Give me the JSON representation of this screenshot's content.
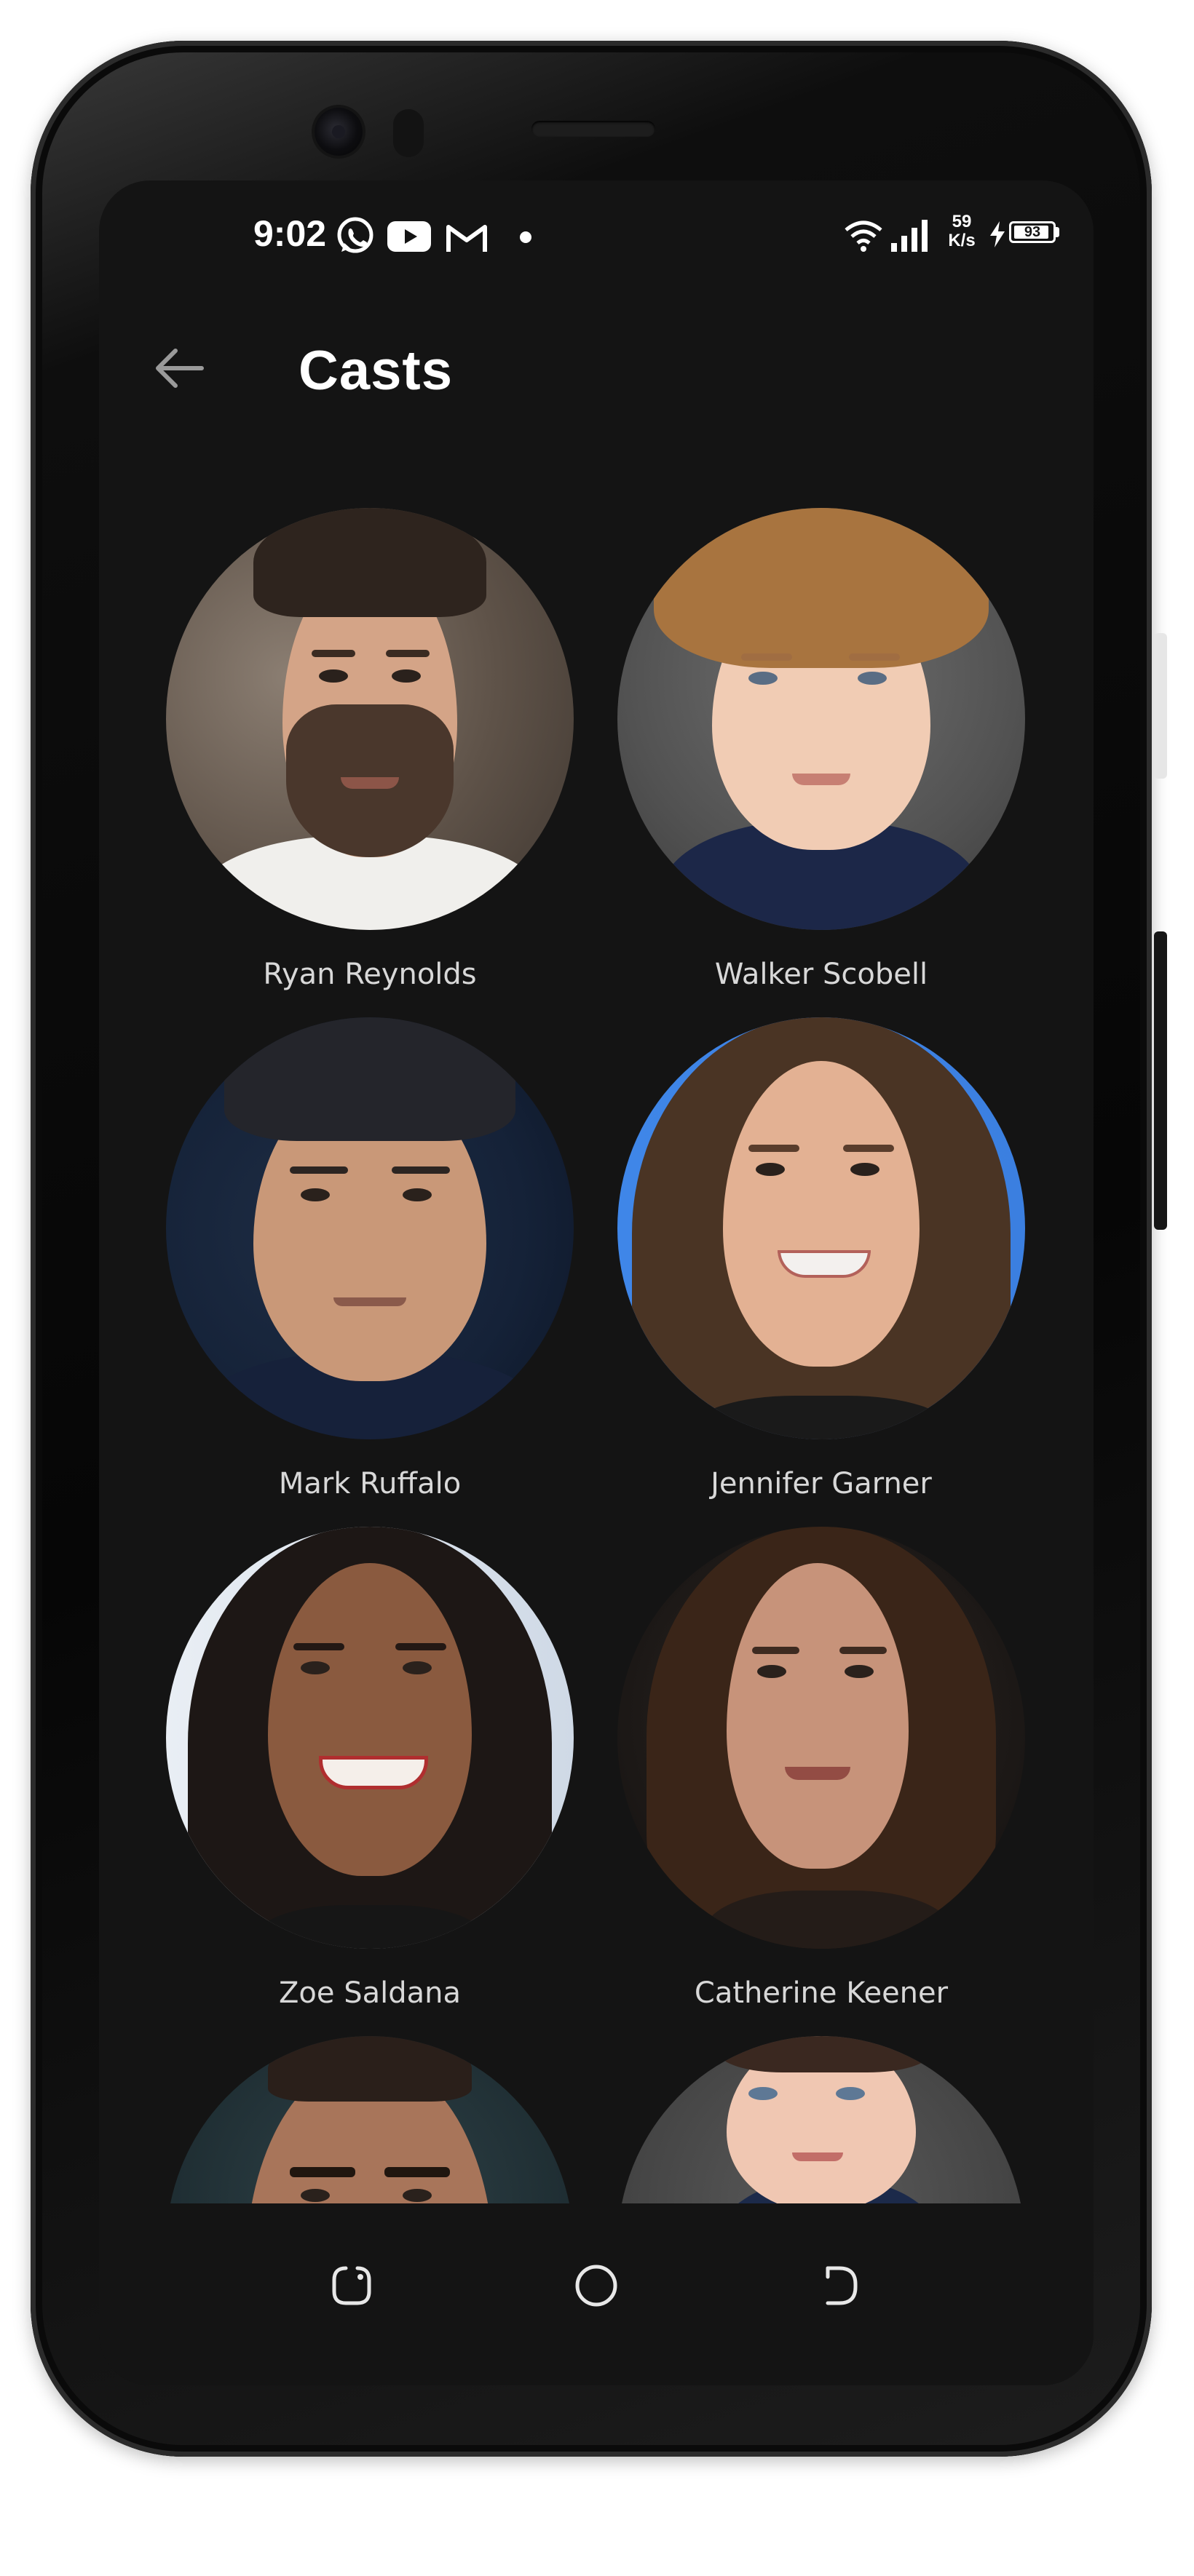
{
  "status_bar": {
    "time": "9:02",
    "notification_icons": [
      "whatsapp-icon",
      "youtube-icon",
      "gmail-icon"
    ],
    "net_speed_value": "59",
    "net_speed_unit": "K/s",
    "battery_level": "93",
    "battery_fraction": 0.93
  },
  "app_bar": {
    "title": "Casts",
    "back_icon": "arrow-left-icon"
  },
  "cast": [
    {
      "name": "Ryan Reynolds"
    },
    {
      "name": "Walker Scobell"
    },
    {
      "name": "Mark Ruffalo"
    },
    {
      "name": "Jennifer Garner"
    },
    {
      "name": "Zoe Saldana"
    },
    {
      "name": "Catherine Keener"
    },
    {
      "name": ""
    },
    {
      "name": ""
    }
  ],
  "nav_bar": {
    "icons": [
      "recent-apps-icon",
      "home-icon",
      "back-icon"
    ]
  },
  "colors": {
    "background": "#141414",
    "text_primary": "#ffffff",
    "text_secondary": "#d8d8d8"
  }
}
